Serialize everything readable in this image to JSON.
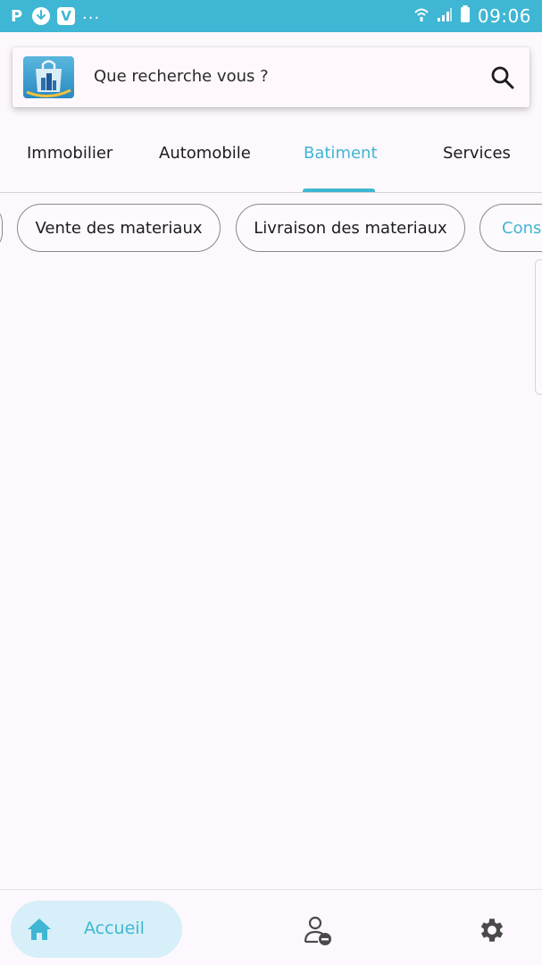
{
  "status_bar": {
    "left_letter": "P",
    "v_letter": "V",
    "more": "...",
    "time": "09:06"
  },
  "search": {
    "placeholder": "Que recherche vous ?"
  },
  "tabs": [
    {
      "label": "Immobilier"
    },
    {
      "label": "Automobile"
    },
    {
      "label": "Batiment",
      "active": true
    },
    {
      "label": "Services"
    }
  ],
  "chips": [
    {
      "label": ""
    },
    {
      "label": "Vente des materiaux"
    },
    {
      "label": "Livraison des materiaux"
    },
    {
      "label": "Cons"
    }
  ],
  "bottom_nav": {
    "home_label": "Accueil",
    "home_icon": "home-icon",
    "profile_icon": "user-remove-icon",
    "settings_icon": "gear-icon"
  },
  "colors": {
    "accent": "#3fb6d3",
    "background": "#fcf8fc"
  }
}
